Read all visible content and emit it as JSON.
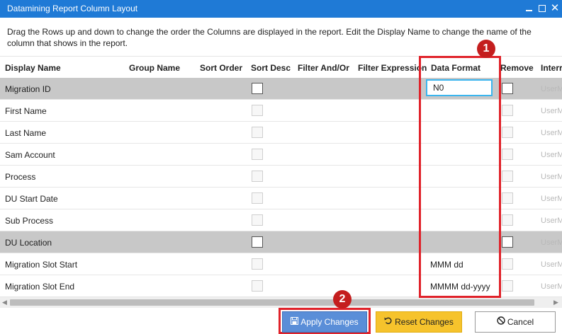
{
  "window": {
    "title": "Datamining Report Column Layout",
    "minimize_icon": "minimize-icon",
    "maximize_icon": "maximize-icon",
    "close_glyph": "✕"
  },
  "instructions": "Drag the Rows up and down to change the order the Columns are displayed in the report. Edit the Display Name to change the name of the column that shows in the report.",
  "grid": {
    "headers": [
      "Display Name",
      "Group Name",
      "Sort Order",
      "Sort Desc",
      "Filter And/Or",
      "Filter Expression",
      "Data Format",
      "Remove",
      "Interr"
    ],
    "editing_value": "N0",
    "rows": [
      {
        "display_name": "Migration ID",
        "data_format": "",
        "intern": "UserM"
      },
      {
        "display_name": "First Name",
        "data_format": "",
        "intern": "UserM"
      },
      {
        "display_name": "Last Name",
        "data_format": "",
        "intern": "UserM"
      },
      {
        "display_name": "Sam Account",
        "data_format": "",
        "intern": "UserM"
      },
      {
        "display_name": "Process",
        "data_format": "",
        "intern": "UserM"
      },
      {
        "display_name": "DU Start Date",
        "data_format": "",
        "intern": "UserM"
      },
      {
        "display_name": "Sub Process",
        "data_format": "",
        "intern": "UserM"
      },
      {
        "display_name": "DU Location",
        "data_format": "",
        "intern": "UserM"
      },
      {
        "display_name": "Migration Slot Start",
        "data_format": "MMM dd",
        "intern": "UserM"
      },
      {
        "display_name": "Migration Slot End",
        "data_format": "MMMM dd-yyyy",
        "intern": "UserM"
      }
    ]
  },
  "annotations": {
    "badge1": "1",
    "badge2": "2",
    "color": "#e0222a"
  },
  "buttons": {
    "apply": "Apply Changes",
    "reset": "Reset Changes",
    "cancel": "Cancel",
    "apply_color": "#5a8ed8",
    "reset_color": "#f6c32c"
  },
  "colors": {
    "titlebar": "#1f7ad6",
    "selected_row": "#c8c8c8",
    "edit_border": "#3bb5ee"
  }
}
